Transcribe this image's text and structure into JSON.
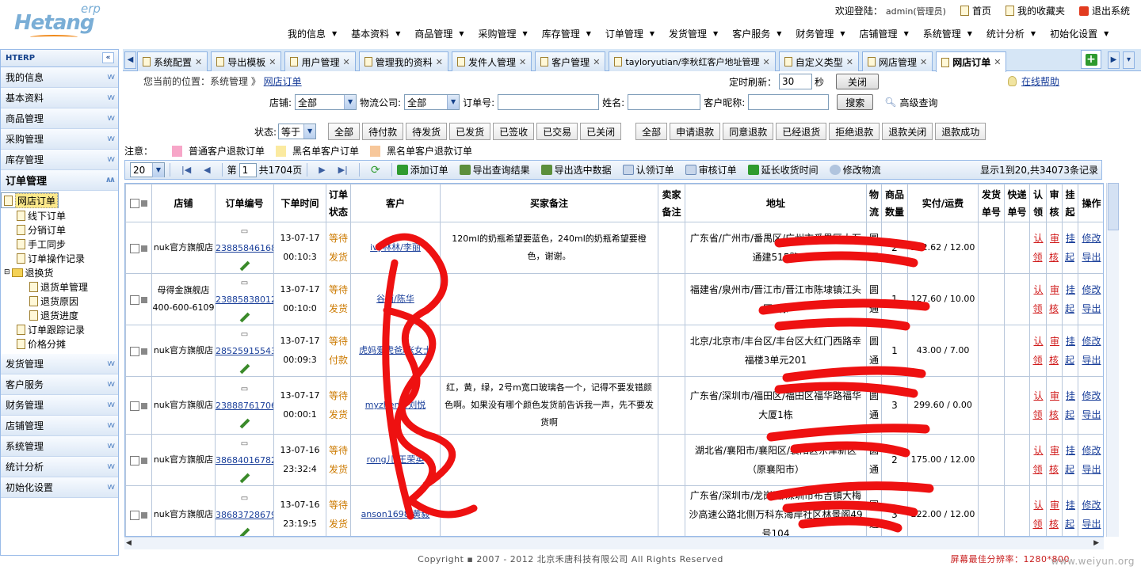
{
  "header": {
    "logo_brand": "Hetang",
    "logo_sub": "erp",
    "welcome_label": "欢迎登陆：",
    "user": "admin(管理员)",
    "home": "首页",
    "favorites": "我的收藏夹",
    "logout": "退出系统",
    "menu": [
      "我的信息",
      "基本资料",
      "商品管理",
      "采购管理",
      "库存管理",
      "订单管理",
      "发货管理",
      "客户服务",
      "财务管理",
      "店铺管理",
      "系统管理",
      "统计分析",
      "初始化设置"
    ]
  },
  "tabs": [
    "系统配置",
    "导出模板",
    "用户管理",
    "管理我的资料",
    "发件人管理",
    "客户管理",
    "tayloryutian/李秋红客户地址管理",
    "自定义类型",
    "网店管理",
    "网店订单"
  ],
  "sidebar": {
    "title": "HTERP",
    "collapse_label": "«",
    "top_items": [
      "我的信息",
      "基本资料",
      "商品管理",
      "采购管理",
      "库存管理"
    ],
    "open_item": "订单管理",
    "tree": [
      "网店订单",
      "线下订单",
      "分销订单",
      "手工同步",
      "订单操作记录",
      "退换货",
      "退货单管理",
      "退货原因",
      "退货进度",
      "订单跟踪记录",
      "价格分摊"
    ],
    "bottom_items": [
      "发货管理",
      "客户服务",
      "财务管理",
      "店铺管理",
      "系统管理",
      "统计分析",
      "初始化设置"
    ]
  },
  "breadcrumb": {
    "prefix": "您当前的位置：系统管理 》",
    "current": "网店订单"
  },
  "refresh": {
    "label": "定时刷新：",
    "value": "30",
    "unit": "秒",
    "button": "关闭"
  },
  "help": "在线帮助",
  "filter": {
    "shop_label": "店铺:",
    "shop_value": "全部",
    "logistics_label": "物流公司:",
    "logistics_value": "全部",
    "order_no_label": "订单号:",
    "name_label": "姓名:",
    "nick_label": "客户昵称:",
    "search": "搜索",
    "advanced": "高级查询"
  },
  "state": {
    "label": "状态:",
    "op": "等于",
    "buttons1": [
      "全部",
      "待付款",
      "待发货",
      "已发货",
      "已签收",
      "已交易",
      "已关闭"
    ],
    "buttons2": [
      "全部",
      "申请退款",
      "同意退款",
      "已经退货",
      "拒绝退款",
      "退款关闭",
      "退款成功"
    ]
  },
  "legend": {
    "label": "注意：",
    "items": [
      {
        "text": "普通客户退款订单",
        "color": "#f7a6c8"
      },
      {
        "text": "黑名单客户订单",
        "color": "#fbeaa0"
      },
      {
        "text": "黑名单客户退款订单",
        "color": "#f7c79a"
      }
    ]
  },
  "toolbar": {
    "page_size": "20",
    "page_prefix": "第",
    "page": "1",
    "page_total": "共1704页",
    "actions": [
      "添加订单",
      "导出查询结果",
      "导出选中数据",
      "认领订单",
      "审核订单",
      "延长收货时间",
      "修改物流"
    ],
    "count": "显示1到20,共34073条记录"
  },
  "grid": {
    "headers": [
      "店铺",
      "订单编号",
      "下单时间",
      "订单状态",
      "客户",
      "买家备注",
      "卖家备注",
      "地址",
      "物流",
      "商品数量",
      "实付/运费",
      "发货单号",
      "快递单号",
      "认领",
      "审核",
      "挂起",
      "操作"
    ],
    "rows": [
      {
        "shop": "nuk官方旗舰店",
        "shop2": "",
        "order": "238858461689",
        "date": "13-07-17",
        "time": "00:10:3",
        "status": "等待发货",
        "cust": "ivy林林/李丽",
        "note": "120ml的奶瓶希望要蓝色，240ml的奶瓶希望要橙色，谢谢。",
        "addr": "广东省/广州市/番禺区/广州市番禺区大石通建515路",
        "logi": "圆通",
        "qty": "2",
        "pay": "212.62 / 12.00"
      },
      {
        "shop": "母得金旗舰店",
        "shop2": "400-600-6109",
        "order": "238858380128",
        "date": "13-07-17",
        "time": "00:10:0",
        "status": "等待发货",
        "cust": "谷雨/陈华",
        "note": "",
        "addr": "福建省/泉州市/晋江市/晋江市陈埭镇江头园8栋",
        "logi": "圆通",
        "qty": "1",
        "pay": "127.60 / 10.00"
      },
      {
        "shop": "nuk官方旗舰店",
        "shop2": "",
        "order": "285259155433",
        "date": "13-07-17",
        "time": "00:09:3",
        "status": "等待付款",
        "cust": "虎妈爱虎爸/张女士",
        "note": "",
        "addr": "北京/北京市/丰台区/丰台区大红门西路幸福楼3单元201",
        "logi": "圆通",
        "qty": "1",
        "pay": "43.00 / 7.00"
      },
      {
        "shop": "nuk官方旗舰店",
        "shop2": "",
        "order": "238887617060",
        "date": "13-07-17",
        "time": "00:00:1",
        "status": "等待发货",
        "cust": "myzhen8/刘悦",
        "note": "红，黄，绿，2号m宽口玻璃各一个，记得不要发错颜色啊。如果没有哪个颜色发货前告诉我一声，先不要发货啊",
        "addr": "广东省/深圳市/福田区/福田区福华路福华大厦1栋",
        "logi": "圆通",
        "qty": "3",
        "pay": "299.60 / 0.00"
      },
      {
        "shop": "nuk官方旗舰店",
        "shop2": "",
        "order": "386840167822",
        "date": "13-07-16",
        "time": "23:32:4",
        "status": "等待发货",
        "cust": "rong儿/王荣英",
        "note": "",
        "addr": "湖北省/襄阳市/襄阳区/襄阳区东津新区（原襄阳市）",
        "logi": "圆通",
        "qty": "2",
        "pay": "175.00 / 12.00"
      },
      {
        "shop": "nuk官方旗舰店",
        "shop2": "",
        "order": "386837286794",
        "date": "13-07-16",
        "time": "23:19:5",
        "status": "等待发货",
        "cust": "anson1698/黄毅",
        "note": "",
        "addr": "广东省/深圳市/龙岗区/深圳市布吉镇大梅沙高速公路北侧万科东海岸社区林景阁49号104",
        "logi": "圆通",
        "qty": "3",
        "pay": "222.00 / 12.00"
      }
    ],
    "ops": {
      "claim": "认领",
      "audit": "审核",
      "hang": "挂起",
      "edit": "修改",
      "export": "导出"
    }
  },
  "footer": {
    "copyright": "Copyright  ▪  2007 - 2012 北京禾唐科技有限公司 All Rights Reserved",
    "resolution": "屏幕最佳分辨率：1280*800",
    "watermark": "www.weiyun.org"
  }
}
